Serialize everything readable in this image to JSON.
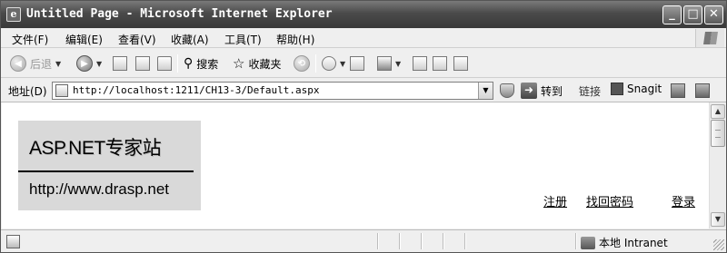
{
  "window": {
    "title": "Untitled Page - Microsoft Internet Explorer",
    "controls": {
      "minimize": "_",
      "maximize": "□",
      "close": "✕"
    }
  },
  "menu": {
    "items": [
      "文件(F)",
      "编辑(E)",
      "查看(V)",
      "收藏(A)",
      "工具(T)",
      "帮助(H)"
    ]
  },
  "toolbar": {
    "back_label": "后退",
    "search_label": "搜索",
    "favorites_label": "收藏夹"
  },
  "address": {
    "label": "地址(D)",
    "url": "http://localhost:1211/CH13-3/Default.aspx",
    "go_label": "转到",
    "links_label": "链接",
    "snagit_label": "Snagit"
  },
  "page": {
    "logo": {
      "title": "ASP.NET专家站",
      "url": "http://www.drasp.net"
    },
    "links": {
      "register": "注册",
      "forgot_password": "找回密码",
      "login": "登录"
    }
  },
  "status": {
    "zone": "本地 Intranet"
  }
}
